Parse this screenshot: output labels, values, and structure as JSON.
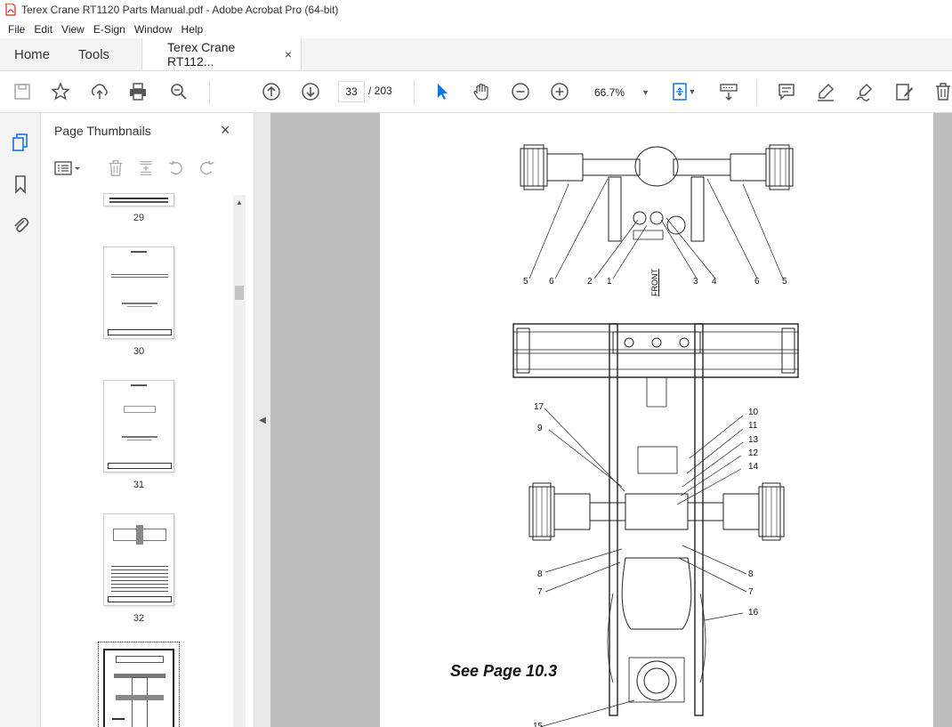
{
  "window": {
    "title": "Terex Crane RT1120 Parts Manual.pdf - Adobe Acrobat Pro (64-bit)"
  },
  "menu": [
    "File",
    "Edit",
    "View",
    "E-Sign",
    "Window",
    "Help"
  ],
  "tabs": {
    "home": "Home",
    "tools": "Tools",
    "document": "Terex Crane RT112...",
    "close": "×"
  },
  "toolbar": {
    "page_current": "33",
    "page_sep_total": "/ 203",
    "zoom": "66.7%",
    "icons": [
      "save-icon",
      "star-icon",
      "upload-icon",
      "print-icon",
      "zoom-search-icon",
      "page-up-icon",
      "page-down-icon",
      "select-arrow-icon",
      "hand-icon",
      "zoom-out-icon",
      "zoom-in-icon",
      "fit-page-icon",
      "scroll-mode-icon",
      "comment-icon",
      "highlight-pen-icon",
      "sign-icon",
      "fill-sign-icon",
      "delete-icon"
    ]
  },
  "panel": {
    "title": "Page Thumbnails",
    "close": "×",
    "thumbnails": [
      {
        "label": "29"
      },
      {
        "label": "30"
      },
      {
        "label": "31"
      },
      {
        "label": "32"
      },
      {
        "label": ""
      }
    ]
  },
  "document": {
    "see_page": "See Page 10.3",
    "front": "FRONT",
    "top_callouts": [
      "5",
      "6",
      "2",
      "1",
      "3",
      "4",
      "6",
      "5"
    ],
    "main_callouts": [
      "17",
      "9",
      "10",
      "11",
      "13",
      "12",
      "14",
      "8",
      "7",
      "8",
      "7",
      "16",
      "15"
    ]
  },
  "colors": {
    "accent": "#1473e6",
    "viewer_bg": "#bdbdbd",
    "panel_border": "#dcdcdc"
  }
}
